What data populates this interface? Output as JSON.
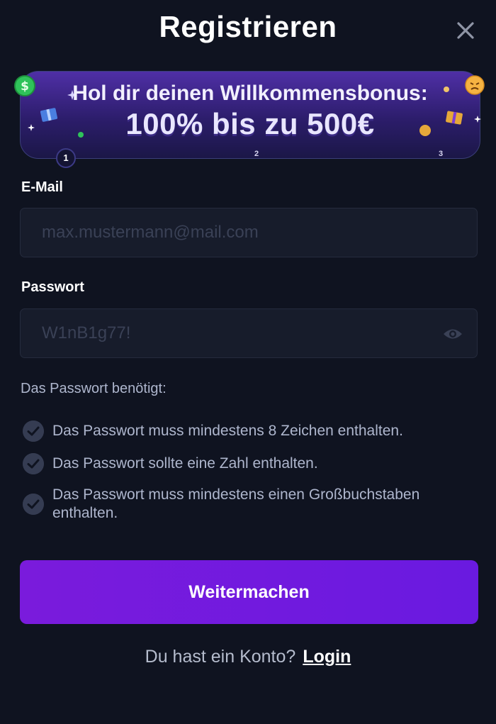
{
  "header": {
    "title": "Registrieren",
    "close_icon": "close-icon"
  },
  "banner": {
    "line1": "Hol dir deinen Willkommensbonus:",
    "line2": "100% bis zu 500€",
    "slides": [
      "1",
      "2",
      "3"
    ],
    "active_slide": 1
  },
  "form": {
    "email": {
      "label": "E-Mail",
      "placeholder": "max.mustermann@mail.com",
      "value": ""
    },
    "password": {
      "label": "Passwort",
      "placeholder": "W1nB1g77!",
      "value": "",
      "toggle_icon": "eye-icon"
    }
  },
  "requirements": {
    "title": "Das Passwort benötigt:",
    "items": [
      "Das Passwort muss mindestens 8 Zeichen enthalten.",
      "Das Passwort sollte eine Zahl enthalten.",
      "Das Passwort muss mindestens einen Großbuchstaben enthalten."
    ],
    "icon": "check-circle-icon"
  },
  "actions": {
    "continue_label": "Weitermachen"
  },
  "footer": {
    "prompt": "Du hast ein Konto?",
    "login_label": "Login"
  },
  "colors": {
    "background": "#0f1320",
    "field_bg": "#171c2b",
    "accent": "#7a1bdc",
    "muted_text": "#aeb6cd"
  }
}
